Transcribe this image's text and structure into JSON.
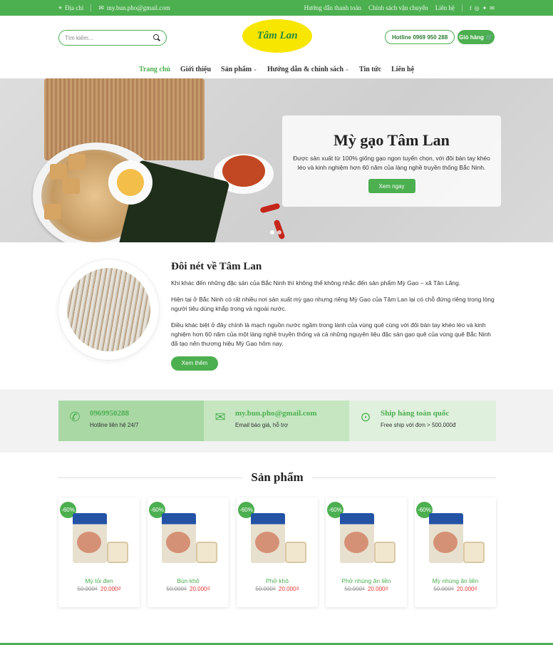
{
  "topbar": {
    "address_label": "Địa chỉ",
    "email": "my.bun.pho@gmail.com",
    "links": [
      "Hướng dẫn thanh toán",
      "Chính sách vận chuyển",
      "Liên hệ"
    ],
    "social_icons": [
      "facebook-icon",
      "instagram-icon",
      "twitter-icon",
      "mail-icon"
    ]
  },
  "header": {
    "search_placeholder": "Tìm kiếm...",
    "logo_text": "Tâm Lan",
    "hotline": "Hotline 0969 950 288",
    "cart": "Giỏ hàng"
  },
  "nav": {
    "items": [
      "Trang chủ",
      "Giới thiệu",
      "Sản phẩm",
      "Hướng dẫn & chính sách",
      "Tin tức",
      "Liên hệ"
    ]
  },
  "hero": {
    "title": "Mỳ gạo Tâm Lan",
    "text": "Được sản xuất từ 100% giống gạo ngon tuyển chọn, với đôi bàn tay khéo léo và kinh nghiệm hơn 60 năm của làng nghề truyền thống Bắc Ninh.",
    "button": "Xem ngay"
  },
  "about": {
    "title": "Đôi nét về Tâm Lan",
    "paragraphs": [
      "Khi khác đến những đặc sản của Bắc Ninh thì không thể không nhắc đến sản phẩm Mỳ Gạo – xã Tân Lãng.",
      "Hiện tại ở Bắc Ninh có rất nhiều nơi sản xuất mỳ gạo nhưng riêng Mỳ Gạo của Tâm Lan lại có chỗ đứng riêng trong lòng người tiêu dùng khắp trong và ngoài nước.",
      "Điều khác biệt ở đây chính là mạch nguồn nước ngầm trong lành của vùng quê cùng với đôi bàn tay khéo léo và kinh nghiệm hơn 60 năm của một làng nghề truyền thống và cả những nguyên liệu đặc sản gạo quê của vùng quê Bắc Ninh đã tạo nên thương hiệu Mỳ Gạo hôm nay."
    ],
    "button": "Xem thêm"
  },
  "contacts": [
    {
      "title": "0969950288",
      "sub": "Hotline liên hệ 24/7",
      "icon": "phone-icon",
      "bg": "#a9d8a5"
    },
    {
      "title": "my.bun.pho@gmail.com",
      "sub": "Email báo giá, hỗ trợ",
      "icon": "mail-icon",
      "bg": "#c5e6c1"
    },
    {
      "title": "Ship hàng toàn quốc",
      "sub": "Free ship với đơn > 500.000đ",
      "icon": "location-icon",
      "bg": "#dff0dd"
    }
  ],
  "products_title": "Sản phẩm",
  "products": [
    {
      "badge": "-60%",
      "name": "Mỳ tỏi đen",
      "old_price": "50.000₫",
      "new_price": "20.000₫"
    },
    {
      "badge": "-60%",
      "name": "Bún khô",
      "old_price": "50.000₫",
      "new_price": "20.000₫"
    },
    {
      "badge": "-60%",
      "name": "Phở khô",
      "old_price": "50.000₫",
      "new_price": "20.000₫"
    },
    {
      "badge": "-60%",
      "name": "Phở nhúng ăn liền",
      "old_price": "50.000₫",
      "new_price": "20.000₫"
    },
    {
      "badge": "-60%",
      "name": "Mỳ nhúng ăn liền",
      "old_price": "50.000₫",
      "new_price": "20.000₫"
    }
  ],
  "colors": {
    "brand": "#4caf50",
    "sale": "#e53935",
    "logo_bg": "#f7e600"
  }
}
